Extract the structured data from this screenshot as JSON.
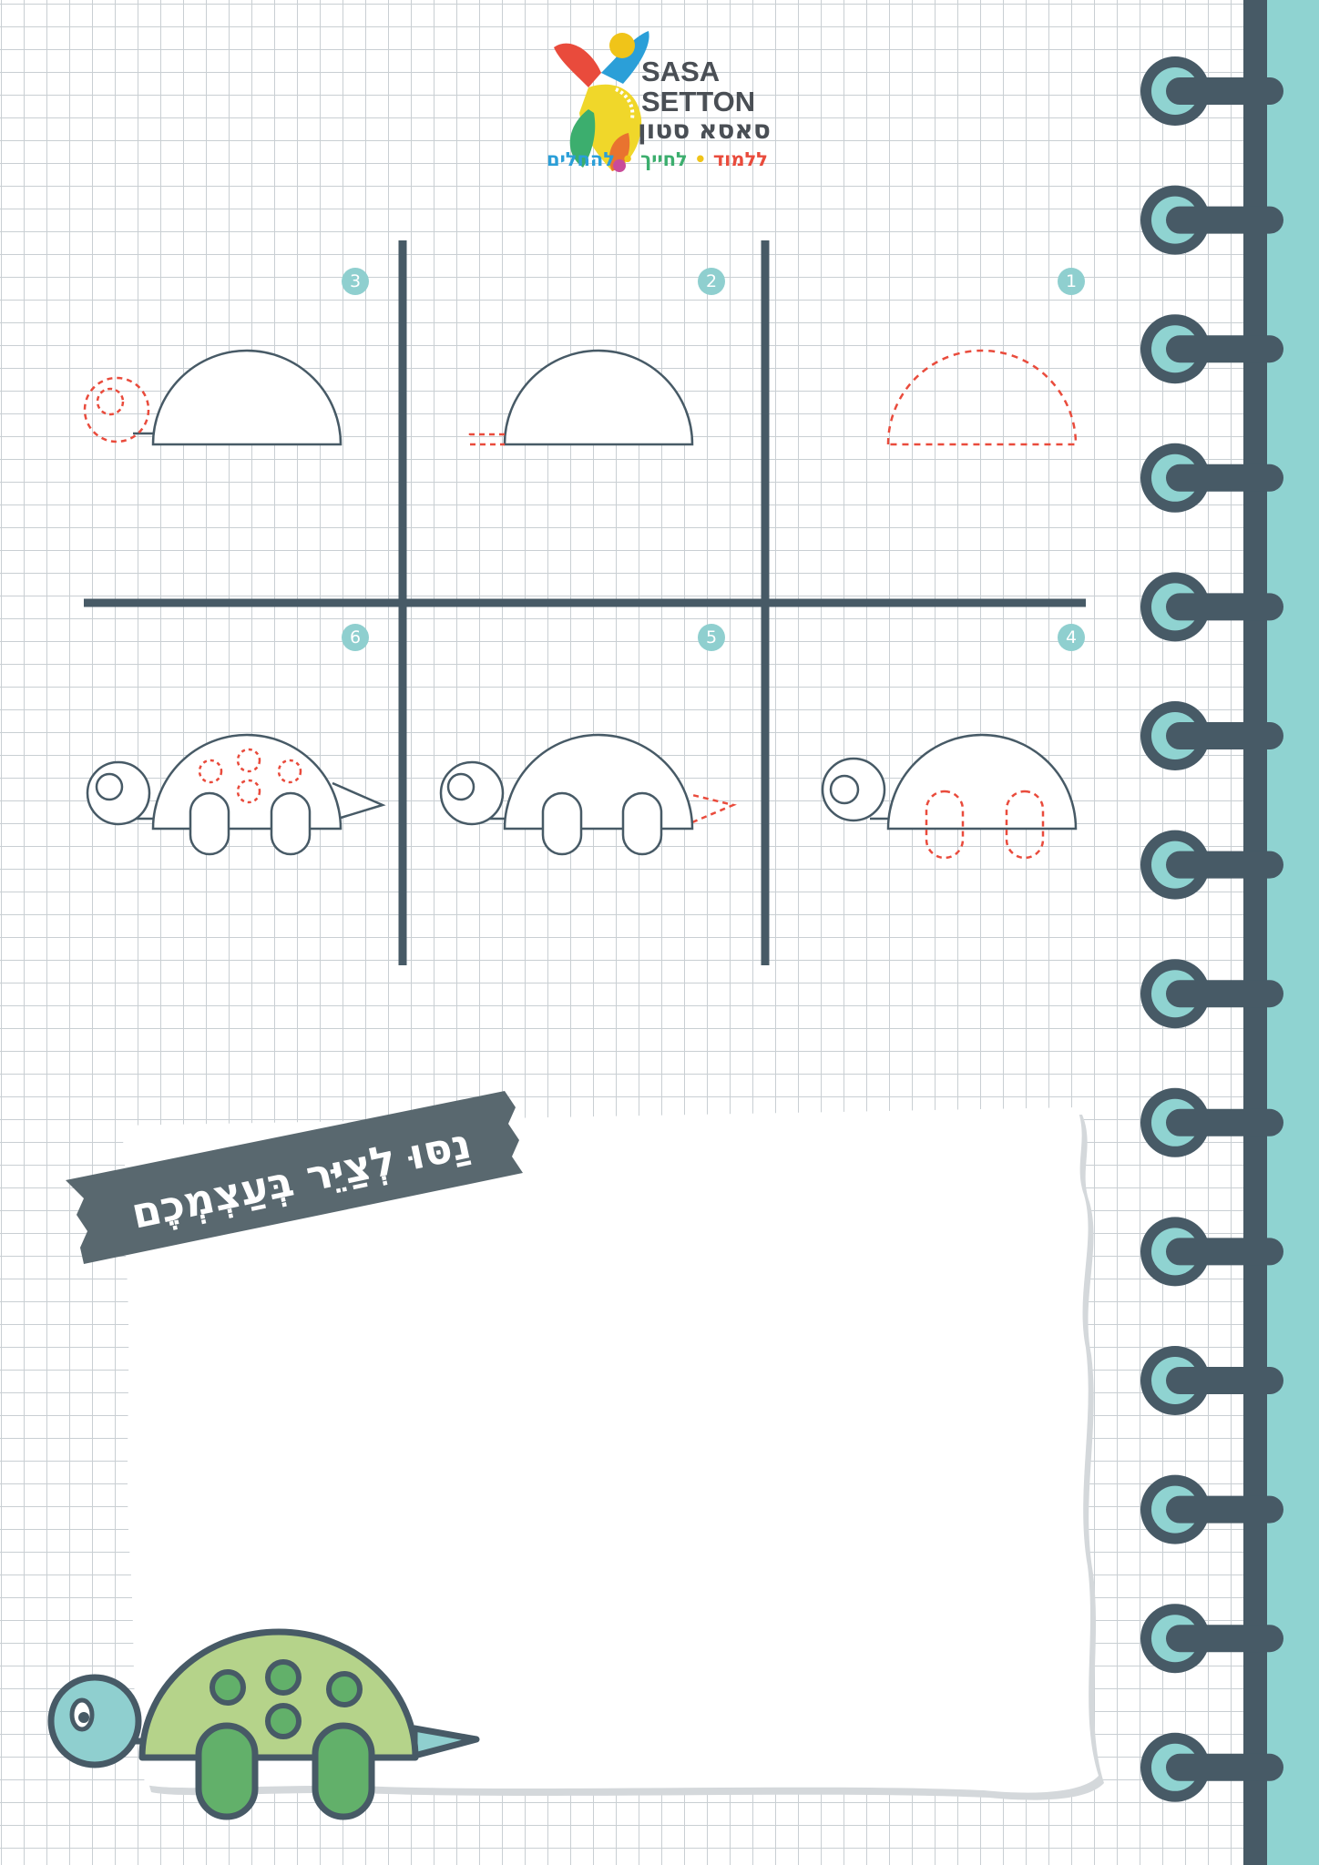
{
  "brand": {
    "name_en_line1": "SASA",
    "name_en_line2": "SETTON",
    "name_he": "סאסא סטון",
    "tagline": [
      "ללמוד",
      "לחייך",
      "להחלים"
    ],
    "tagline_colors": [
      "#e94b3c",
      "#3cae6e",
      "#2b9fd8"
    ],
    "dot_color": "#f0c419"
  },
  "steps": [
    "1",
    "2",
    "3",
    "4",
    "5",
    "6"
  ],
  "banner": {
    "text": "נַסּוּ לְצַיֵּר בְּעַצְמְכֶם"
  },
  "colors": {
    "outline": "#475a66",
    "guide": "#e94b3c",
    "step_badge": "#8fcfcf",
    "spiral_teal": "#8fd3d1",
    "turtle_shell": "#b5d38a",
    "turtle_spot": "#62b06a",
    "turtle_head": "#8fcfcf"
  }
}
